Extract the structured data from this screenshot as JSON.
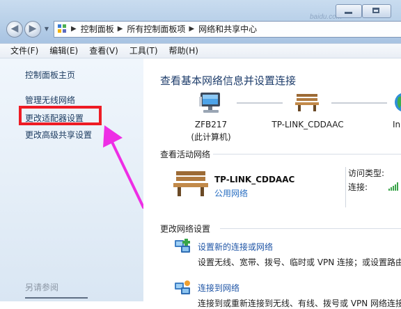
{
  "window": {
    "watermark": "baidu.com"
  },
  "navigation": {
    "back_glyph": "◀",
    "forward_glyph": "▶",
    "history_glyph": "▼",
    "breadcrumb": [
      "控制面板",
      "所有控制面板项",
      "网络和共享中心"
    ],
    "separator_glyph": "▶"
  },
  "menu": {
    "items": [
      "文件(F)",
      "编辑(E)",
      "查看(V)",
      "工具(T)",
      "帮助(H)"
    ]
  },
  "left_pane": {
    "tasks": [
      "控制面板主页",
      "管理无线网络",
      "更改适配器设置",
      "更改高级共享设置"
    ],
    "highlighted_task": "更改适配器设置",
    "see_also_heading": "另请参阅"
  },
  "main": {
    "title": "查看基本网络信息并设置连接",
    "map_nodes": [
      {
        "label_line1": "ZFB217",
        "label_line2": "(此计算机)",
        "icon": "computer-icon"
      },
      {
        "label_line1": "TP-LINK_CDDAAC",
        "label_line2": "",
        "icon": "bench-icon"
      },
      {
        "label_line1": "In",
        "label_line2": "",
        "icon": "globe-icon"
      }
    ],
    "active_networks_heading": "查看活动网络",
    "active_network": {
      "name": "TP-LINK_CDDAAC",
      "type": "公用网络",
      "access_type_label": "访问类型:",
      "connection_label": "连接:"
    },
    "change_settings_heading": "更改网络设置",
    "actions": [
      {
        "link": "设置新的连接或网络",
        "description": "设置无线、宽带、拨号、临时或 VPN 连接；或设置路由"
      },
      {
        "link": "连接到网络",
        "description": "连接到或重新连接到无线、有线、拨号或 VPN 网络连接"
      }
    ]
  },
  "colors": {
    "highlight": "#ee1c24",
    "arrow": "#ee2ee5",
    "link": "#1f55a6",
    "title": "#1e3d6b"
  }
}
